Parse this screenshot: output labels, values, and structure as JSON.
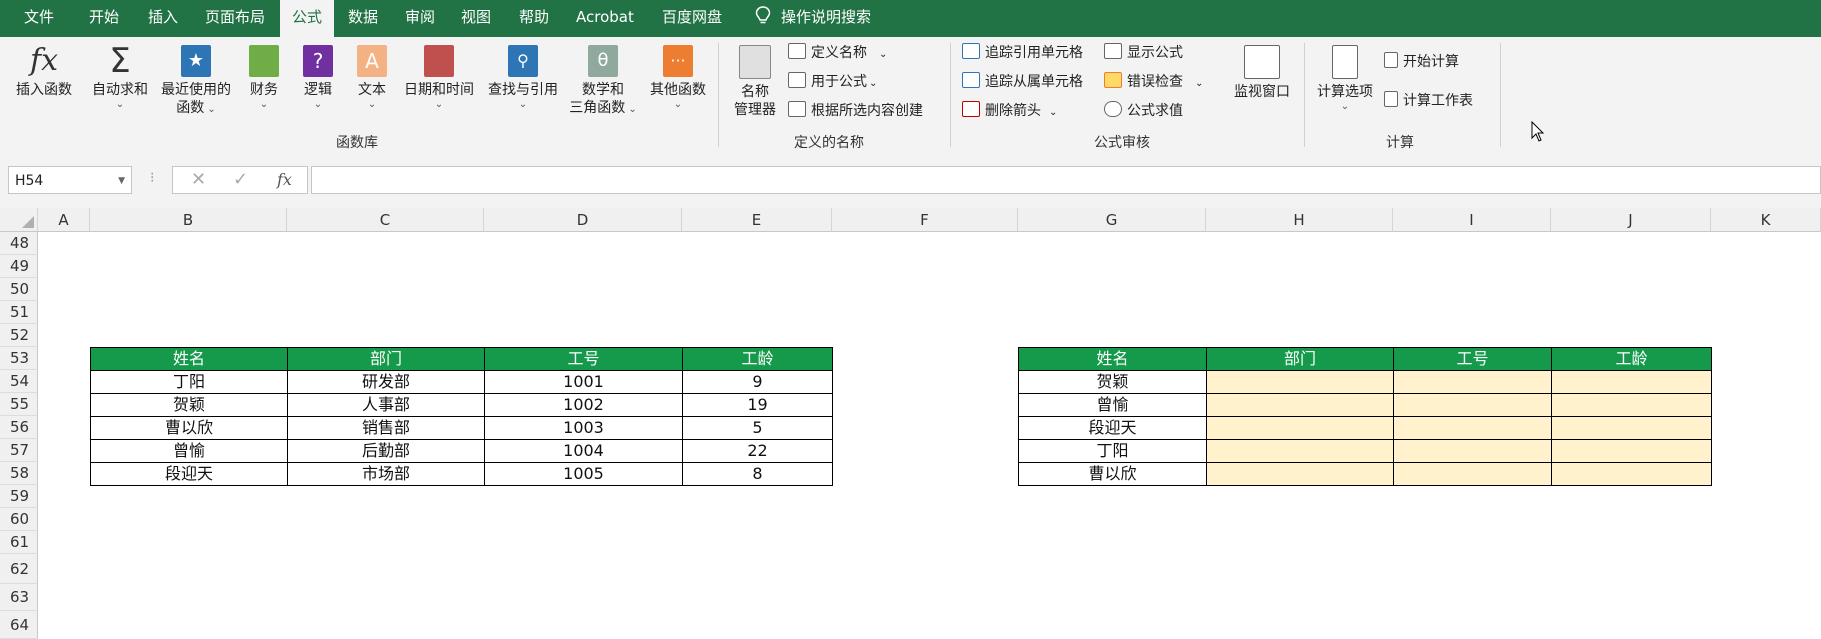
{
  "menu": {
    "tabs": [
      "文件",
      "开始",
      "插入",
      "页面布局",
      "公式",
      "数据",
      "审阅",
      "视图",
      "帮助",
      "Acrobat",
      "百度网盘"
    ],
    "search_label": "操作说明搜索"
  },
  "ribbon": {
    "function_library": {
      "insert_function": "插入函数",
      "autosum": "自动求和",
      "recent_line1": "最近使用的",
      "recent_line2": "函数",
      "financial": "财务",
      "logical": "逻辑",
      "text": "文本",
      "datetime": "日期和时间",
      "lookup": "查找与引用",
      "math_line1": "数学和",
      "math_line2": "三角函数",
      "other": "其他函数",
      "group_label": "函数库"
    },
    "defined_names": {
      "name_manager_line1": "名称",
      "name_manager_line2": "管理器",
      "define_name": "定义名称",
      "use_in_formula": "用于公式",
      "create_from_selection": "根据所选内容创建",
      "group_label": "定义的名称"
    },
    "formula_auditing": {
      "trace_precedents": "追踪引用单元格",
      "trace_dependents": "追踪从属单元格",
      "remove_arrows": "删除箭头",
      "show_formulas": "显示公式",
      "error_checking": "错误检查",
      "evaluate_formula": "公式求值",
      "watch_window": "监视窗口",
      "group_label": "公式审核"
    },
    "calculation": {
      "calc_options": "计算选项",
      "calc_now": "开始计算",
      "calc_sheet": "计算工作表",
      "group_label": "计算"
    }
  },
  "formula_bar": {
    "name_box": "H54",
    "fx": "fx",
    "value": ""
  },
  "columns": [
    "A",
    "B",
    "C",
    "D",
    "E",
    "F",
    "G",
    "H",
    "I",
    "J",
    "K"
  ],
  "rows": [
    "48",
    "49",
    "50",
    "51",
    "52",
    "53",
    "54",
    "55",
    "56",
    "57",
    "58",
    "59",
    "60",
    "61",
    "62",
    "63",
    "64"
  ],
  "left_table": {
    "headers": [
      "姓名",
      "部门",
      "工号",
      "工龄"
    ],
    "rows": [
      [
        "丁阳",
        "研发部",
        "1001",
        "9"
      ],
      [
        "贺颖",
        "人事部",
        "1002",
        "19"
      ],
      [
        "曹以欣",
        "销售部",
        "1003",
        "5"
      ],
      [
        "曾愉",
        "后勤部",
        "1004",
        "22"
      ],
      [
        "段迎天",
        "市场部",
        "1005",
        "8"
      ]
    ]
  },
  "right_table": {
    "headers": [
      "姓名",
      "部门",
      "工号",
      "工龄"
    ],
    "names": [
      "贺颖",
      "曾愉",
      "段迎天",
      "丁阳",
      "曹以欣"
    ]
  },
  "colors": {
    "brand_green": "#217346",
    "header_green": "#159a4b",
    "highlight_yellow": "#fff2cc"
  }
}
